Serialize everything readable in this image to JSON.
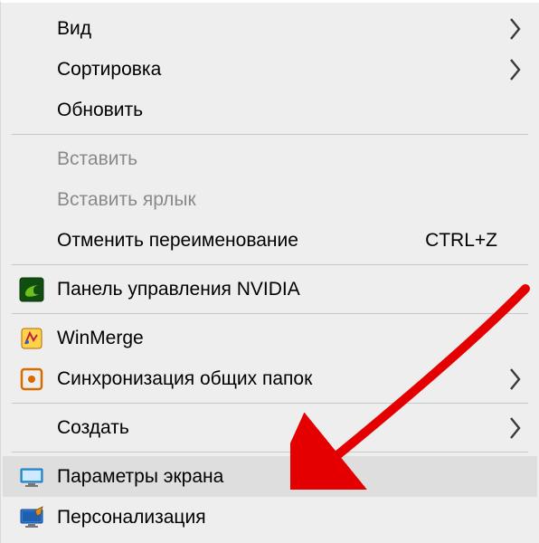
{
  "menu": {
    "items": [
      {
        "label": "Вид",
        "submenu": true
      },
      {
        "label": "Сортировка",
        "submenu": true
      },
      {
        "label": "Обновить"
      }
    ],
    "paste_items": [
      {
        "label": "Вставить",
        "disabled": true
      },
      {
        "label": "Вставить ярлык",
        "disabled": true
      },
      {
        "label": "Отменить переименование",
        "shortcut": "CTRL+Z"
      }
    ],
    "nvidia_item": {
      "label": "Панель управления NVIDIA"
    },
    "third_party": [
      {
        "label": "WinMerge"
      },
      {
        "label": "Синхронизация общих папок",
        "submenu": true
      }
    ],
    "create_item": {
      "label": "Создать",
      "submenu": true
    },
    "settings": [
      {
        "label": "Параметры экрана",
        "highlighted": true
      },
      {
        "label": "Персонализация"
      }
    ]
  }
}
